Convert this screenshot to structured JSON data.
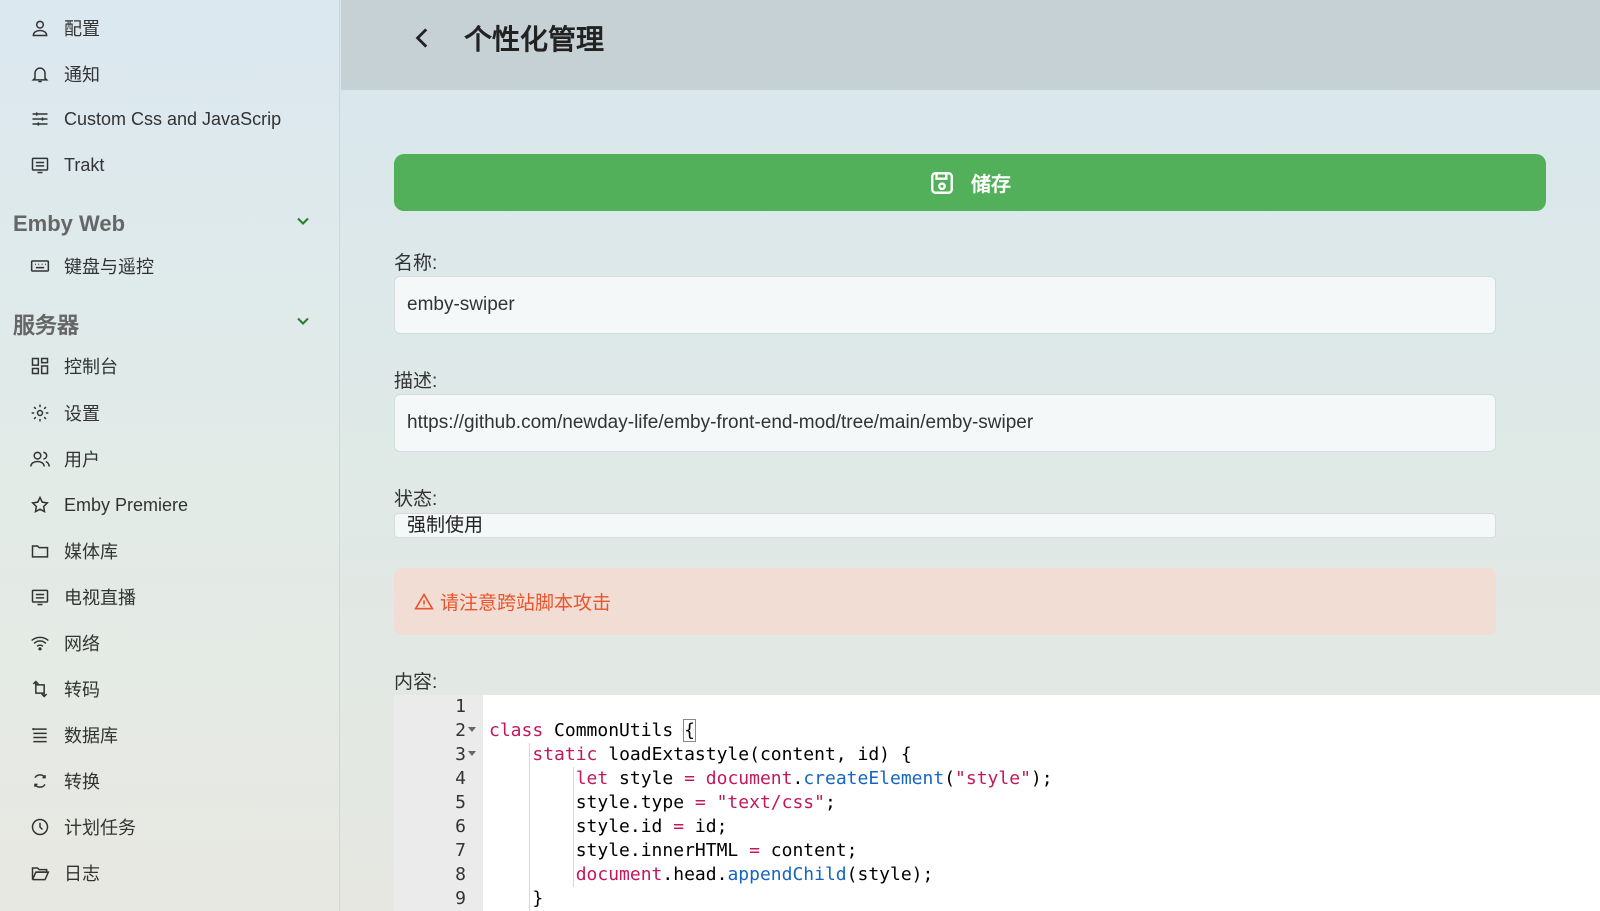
{
  "sidebar": {
    "items_top": [
      {
        "label": "配置",
        "icon": "user-icon"
      },
      {
        "label": "通知",
        "icon": "bell-icon"
      },
      {
        "label": "Custom Css and JavaScrip",
        "icon": "sliders-icon"
      },
      {
        "label": "Trakt",
        "icon": "list-box-icon"
      }
    ],
    "section_web": {
      "title": "Emby Web",
      "items": [
        {
          "label": "键盘与遥控",
          "icon": "keyboard-icon"
        }
      ]
    },
    "section_server": {
      "title": "服务器",
      "items": [
        {
          "label": "控制台",
          "icon": "dashboard-icon"
        },
        {
          "label": "设置",
          "icon": "gear-icon"
        },
        {
          "label": "用户",
          "icon": "users-icon"
        },
        {
          "label": "Emby Premiere",
          "icon": "star-icon"
        },
        {
          "label": "媒体库",
          "icon": "folder-icon"
        },
        {
          "label": "电视直播",
          "icon": "tv-icon"
        },
        {
          "label": "网络",
          "icon": "wifi-icon"
        },
        {
          "label": "转码",
          "icon": "transcode-icon"
        },
        {
          "label": "数据库",
          "icon": "database-icon"
        },
        {
          "label": "转换",
          "icon": "convert-icon"
        },
        {
          "label": "计划任务",
          "icon": "clock-icon"
        },
        {
          "label": "日志",
          "icon": "folder-open-icon"
        }
      ]
    }
  },
  "header": {
    "title": "个性化管理"
  },
  "form": {
    "save_label": "储存",
    "name_label": "名称:",
    "name_value": "emby-swiper",
    "desc_label": "描述:",
    "desc_value": "https://github.com/newday-life/emby-front-end-mod/tree/main/emby-swiper",
    "status_label": "状态:",
    "status_value": "强制使用",
    "warning_text": "请注意跨站脚本攻击",
    "content_label": "内容:"
  },
  "editor": {
    "line_numbers": [
      "1",
      "2",
      "3",
      "4",
      "5",
      "6",
      "7",
      "8",
      "9"
    ],
    "lines": [
      "",
      "class CommonUtils {",
      "    static loadExtastyle(content, id) {",
      "        let style = document.createElement(\"style\");",
      "        style.type = \"text/css\";",
      "        style.id = id;",
      "        style.innerHTML = content;",
      "        document.head.appendChild(style);",
      "    }"
    ]
  },
  "colors": {
    "accent_green": "#52b05a",
    "warning_text": "#e8552c",
    "warning_bg": "#f1ddd3",
    "keyword": "#c2185b",
    "function": "#1565c0"
  }
}
